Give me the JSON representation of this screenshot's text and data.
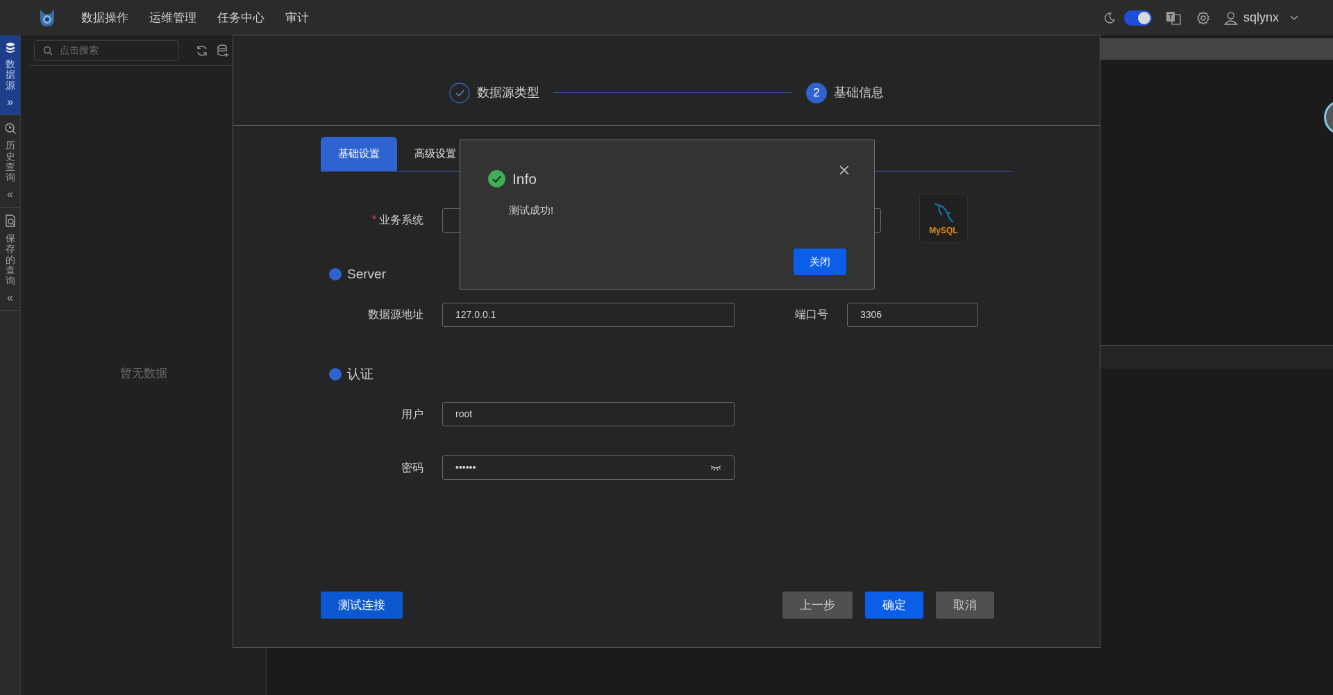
{
  "top_bar": {
    "menu": [
      {
        "label": "数据操作"
      },
      {
        "label": "运维管理"
      },
      {
        "label": "任务中心"
      },
      {
        "label": "审计"
      }
    ],
    "dark_mode_toggle": {
      "on": true
    },
    "user": "sqlynx"
  },
  "side_rail": [
    {
      "label": "数据源",
      "selected": true,
      "chevron": "»"
    },
    {
      "label": "历史查询",
      "selected": false,
      "chevron": "«"
    },
    {
      "label": "保存的查询",
      "selected": false,
      "chevron": "«"
    }
  ],
  "explorer": {
    "search_placeholder": "点击搜索",
    "empty_text": "暂无数据"
  },
  "modal": {
    "steps": [
      {
        "done": true,
        "label": "数据源类型"
      },
      {
        "done": false,
        "number": "2",
        "label": "基础信息"
      }
    ],
    "tabs": [
      {
        "label": "基础设置",
        "selected": true
      },
      {
        "label": "高级设置",
        "selected": false
      }
    ],
    "business_system": {
      "label": "业务系统",
      "required_mark": "*"
    },
    "logo_text": "MySQL",
    "sections": [
      {
        "title": "Server",
        "rows": [
          [
            {
              "kind": "text",
              "label": "数据源地址",
              "value": "127.0.0.1"
            },
            {
              "kind": "text",
              "label": "端口号",
              "value": "3306"
            }
          ]
        ]
      },
      {
        "title": "认证",
        "rows": [
          [
            {
              "kind": "text",
              "label": "用户",
              "value": "root"
            }
          ],
          [
            {
              "kind": "password",
              "label": "密码",
              "value": "••••••"
            }
          ]
        ]
      }
    ],
    "test_button": "测试连接",
    "footer_buttons": [
      {
        "label": "上一步",
        "kind": "secondary"
      },
      {
        "label": "确定",
        "kind": "primary"
      },
      {
        "label": "取消",
        "kind": "secondary"
      }
    ]
  },
  "info_dialog": {
    "title": "Info",
    "message": "测试成功!",
    "button": "关闭"
  }
}
